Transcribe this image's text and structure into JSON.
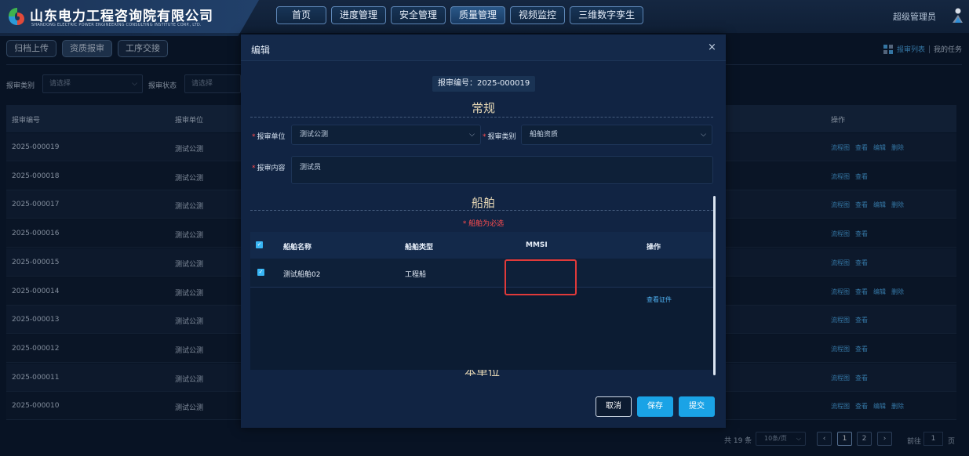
{
  "header": {
    "company_name": "山东电力工程咨询院有限公司",
    "company_en": "SHANDONG ELECTRIC POWER ENGINEERING CONSULTING INSTITUTE CORP., LTD.",
    "nav": [
      "首页",
      "进度管理",
      "安全管理",
      "质量管理",
      "视频监控",
      "三维数字孪生"
    ],
    "active_nav": "质量管理",
    "user": "超级管理员"
  },
  "subtabs": [
    "归档上传",
    "资质报审",
    "工序交接"
  ],
  "right_links": {
    "list": "报审列表",
    "tasks": "我的任务"
  },
  "filters": [
    {
      "label": "报审类别",
      "placeholder": "请选择"
    },
    {
      "label": "报审状态",
      "placeholder": "请选择"
    }
  ],
  "table": {
    "headers": {
      "code": "报审编号",
      "unit": "报审单位",
      "ops": "操作"
    },
    "rows": [
      {
        "code": "2025-000019",
        "unit": "测试公测",
        "ops": [
          "流程图",
          "查看",
          "编辑",
          "删除"
        ]
      },
      {
        "code": "2025-000018",
        "unit": "测试公测",
        "ops": [
          "流程图",
          "查看"
        ]
      },
      {
        "code": "2025-000017",
        "unit": "测试公测",
        "ops": [
          "流程图",
          "查看",
          "编辑",
          "删除"
        ]
      },
      {
        "code": "2025-000016",
        "unit": "测试公测",
        "ops": [
          "流程图",
          "查看"
        ]
      },
      {
        "code": "2025-000015",
        "unit": "测试公测",
        "ops": [
          "流程图",
          "查看"
        ]
      },
      {
        "code": "2025-000014",
        "unit": "测试公测",
        "ops": [
          "流程图",
          "查看",
          "编辑",
          "删除"
        ]
      },
      {
        "code": "2025-000013",
        "unit": "测试公测",
        "ops": [
          "流程图",
          "查看"
        ]
      },
      {
        "code": "2025-000012",
        "unit": "测试公测",
        "ops": [
          "流程图",
          "查看"
        ]
      },
      {
        "code": "2025-000011",
        "unit": "测试公测",
        "ops": [
          "流程图",
          "查看"
        ]
      },
      {
        "code": "2025-000010",
        "unit": "测试公测",
        "ops": [
          "流程图",
          "查看",
          "编辑",
          "删除"
        ]
      }
    ]
  },
  "pagination": {
    "total": "共 19 条",
    "page_size": "10条/页",
    "pages": [
      "1",
      "2"
    ],
    "current": "1",
    "goto_label": "前往",
    "goto_value": "1",
    "unit": "页"
  },
  "modal": {
    "title": "编辑",
    "close": "×",
    "code_label": "报审编号：2025-000019",
    "section_general": "常规",
    "unit_label": "报审单位",
    "unit_value": "测试公测",
    "category_label": "报审类别",
    "category_value": "船舶资质",
    "content_label": "报审内容",
    "content_value": "测试员",
    "section_ship": "船舶",
    "ship_required": "* 船舶为必选",
    "ship_table": {
      "headers": [
        "船舶名称",
        "船舶类型",
        "MMSI",
        "操作"
      ],
      "rows": [
        {
          "name": "测试船舶02",
          "type": "工程船",
          "mmsi": "",
          "op": "查看证件"
        }
      ]
    },
    "section_unit": "本单位",
    "buttons": {
      "cancel": "取消",
      "save": "保存",
      "submit": "提交"
    }
  }
}
